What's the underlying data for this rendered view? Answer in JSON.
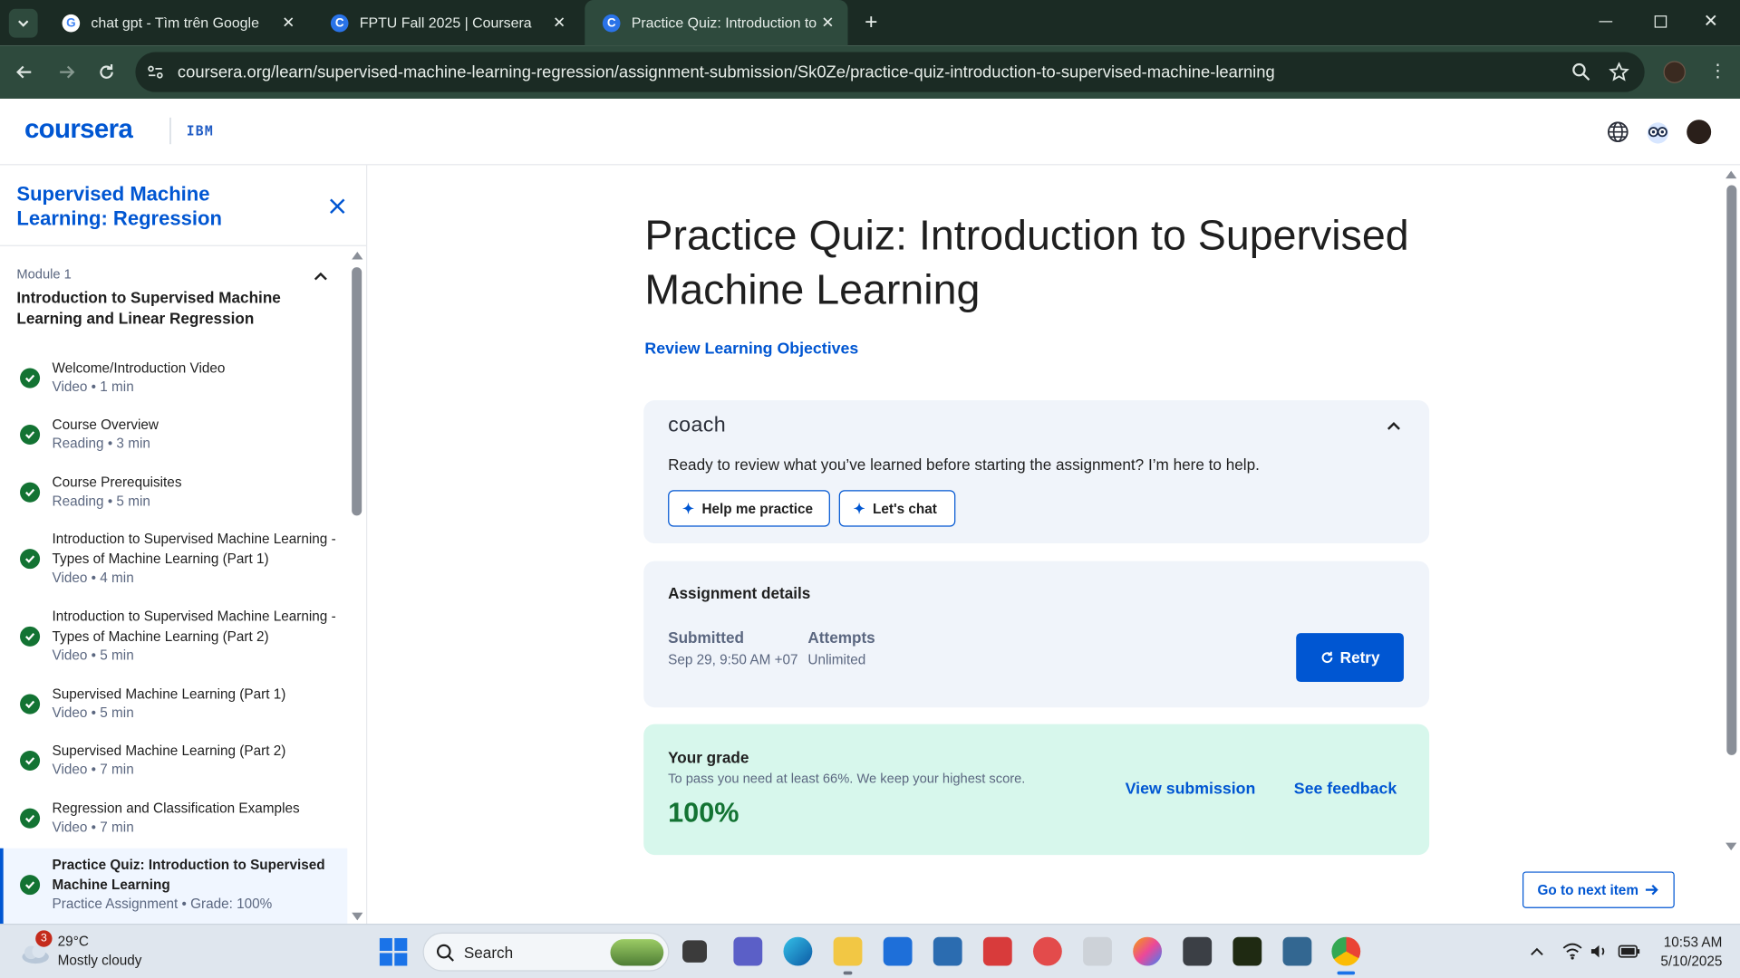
{
  "browser": {
    "tabs": [
      {
        "title": "chat gpt - Tìm trên Google",
        "icon": "google-icon"
      },
      {
        "title": "FPTU Fall 2025 | Coursera",
        "icon": "coursera-icon"
      },
      {
        "title": "Practice Quiz: Introduction to Supervised Machine Learning",
        "icon": "coursera-icon"
      }
    ],
    "url": "coursera.org/learn/supervised-machine-learning-regression/assignment-submission/Sk0Ze/practice-quiz-introduction-to-supervised-machine-learning"
  },
  "header": {
    "logo": "coursera",
    "partner": "IBM"
  },
  "sidebar": {
    "course_title": "Supervised Machine Learning: Regression",
    "module_label": "Module 1",
    "module_title": "Introduction to Supervised Machine Learning and Linear Regression",
    "items": [
      {
        "title": "Welcome/Introduction Video",
        "meta": "Video • 1 min",
        "completed": true
      },
      {
        "title": "Course Overview",
        "meta": "Reading • 3 min",
        "completed": true
      },
      {
        "title": "Course Prerequisites",
        "meta": "Reading • 5 min",
        "completed": true
      },
      {
        "title": "Introduction to Supervised Machine Learning - Types of Machine Learning (Part 1)",
        "meta": "Video • 4 min",
        "completed": true
      },
      {
        "title": "Introduction to Supervised Machine Learning - Types of Machine Learning (Part 2)",
        "meta": "Video • 5 min",
        "completed": true
      },
      {
        "title": "Supervised Machine Learning (Part 1)",
        "meta": "Video • 5 min",
        "completed": true
      },
      {
        "title": "Supervised Machine Learning (Part 2)",
        "meta": "Video • 7 min",
        "completed": true
      },
      {
        "title": "Regression and Classification Examples",
        "meta": "Video • 7 min",
        "completed": true
      },
      {
        "title": "Practice Quiz: Introduction to Supervised Machine Learning",
        "meta": "Practice Assignment • Grade: 100%",
        "completed": true,
        "active": true
      }
    ]
  },
  "main": {
    "title": "Practice Quiz: Introduction to Supervised Machine Learning",
    "review_link": "Review Learning Objectives",
    "coach": {
      "logo": "coach",
      "text": "Ready to review what you’ve learned before starting the assignment? I’m here to help.",
      "buttons": [
        "Help me practice",
        "Let's chat"
      ]
    },
    "details": {
      "heading": "Assignment details",
      "submitted_label": "Submitted",
      "submitted_value": "Sep 29, 9:50 AM +07",
      "attempts_label": "Attempts",
      "attempts_value": "Unlimited",
      "retry_label": "Retry"
    },
    "grade": {
      "heading": "Your grade",
      "subtitle": "To pass you need at least 66%. We keep your highest score.",
      "value": "100%",
      "view_submission": "View submission",
      "see_feedback": "See feedback"
    },
    "next_item": "Go to next item"
  },
  "taskbar": {
    "weather_temp": "29°C",
    "weather_desc": "Mostly cloudy",
    "weather_badge": "3",
    "search_placeholder": "Search",
    "time": "10:53 AM",
    "date": "5/10/2025"
  },
  "colors": {
    "brand": "#0056d2",
    "success": "#137333",
    "chrome_dark": "#1b2b24",
    "chrome_toolbar": "#2e4a3d",
    "grade_bg": "#d7f7ec",
    "card_bg": "#f0f4fa"
  }
}
